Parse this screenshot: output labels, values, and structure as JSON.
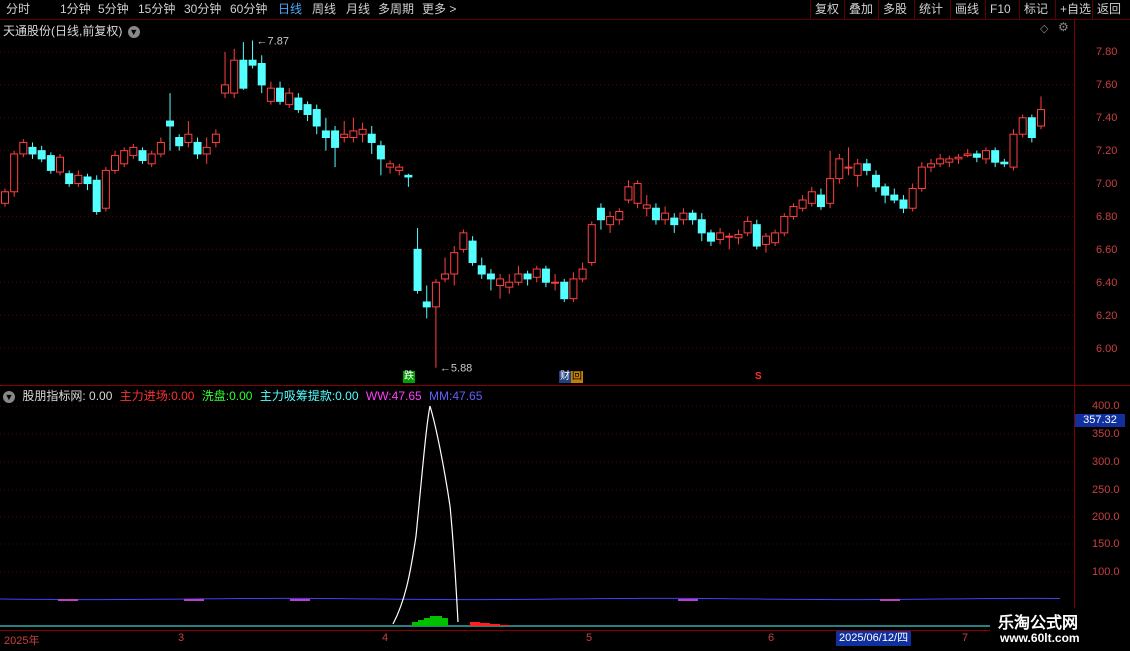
{
  "toolbar": {
    "periods": [
      "分时",
      "1分钟",
      "5分钟",
      "15分钟",
      "30分钟",
      "60分钟",
      "日线",
      "周线",
      "月线",
      "多周期",
      "更多 >"
    ],
    "active_period": "日线",
    "right_buttons": [
      "复权",
      "叠加",
      "多股",
      "统计",
      "画线",
      "F10",
      "标记",
      "+自选",
      "返回"
    ]
  },
  "stock": {
    "title": "天通股份(日线,前复权)"
  },
  "price_axis": {
    "labels": [
      "7.80",
      "7.60",
      "7.40",
      "7.20",
      "7.00",
      "6.80",
      "6.60",
      "6.40",
      "6.20",
      "6.00"
    ]
  },
  "annotations": {
    "high": "7.87",
    "low": "5.88",
    "badge_fall": "跌",
    "badge_fin": "财",
    "badge_hui": "回",
    "badge_s": "S"
  },
  "indicator": {
    "name": "股朋指标网",
    "name_value": ": 0.00",
    "entry_label": "主力进场:",
    "entry_value": "0.00",
    "wash_label": "洗盘:",
    "wash_value": "0.00",
    "absorb_label": "主力吸筹提款:",
    "absorb_value": "0.00",
    "ww_label": "WW:",
    "ww_value": "47.65",
    "mm_label": "MM:",
    "mm_value": "47.65",
    "axis_labels": [
      "400.0",
      "350.0",
      "300.0",
      "250.0",
      "200.0",
      "150.0",
      "100.0"
    ],
    "current_value": "357.32"
  },
  "date_axis": {
    "labels": [
      "2025年",
      "3",
      "4",
      "5",
      "6",
      "7"
    ],
    "highlight": "2025/06/12/四"
  },
  "watermark": {
    "line1": "乐淘公式网",
    "line2": "www.60lt.com"
  },
  "colors": {
    "up": "#ff4040",
    "down": "#54ffff",
    "axis": "#c84040",
    "grid": "#7a0000"
  },
  "chart_data": {
    "type": "candlestick",
    "ylim": [
      5.85,
      7.92
    ],
    "candles": [
      [
        6.88,
        6.95,
        6.97,
        6.86
      ],
      [
        6.95,
        7.18,
        7.2,
        6.92
      ],
      [
        7.18,
        7.25,
        7.27,
        7.16
      ],
      [
        7.22,
        7.18,
        7.25,
        7.15
      ],
      [
        7.2,
        7.15,
        7.23,
        7.13
      ],
      [
        7.17,
        7.08,
        7.19,
        7.06
      ],
      [
        7.07,
        7.16,
        7.18,
        7.05
      ],
      [
        7.06,
        7.0,
        7.08,
        6.98
      ],
      [
        7.0,
        7.05,
        7.08,
        6.98
      ],
      [
        7.04,
        7.0,
        7.06,
        6.96
      ],
      [
        7.02,
        6.83,
        7.05,
        6.81
      ],
      [
        6.85,
        7.08,
        7.1,
        6.83
      ],
      [
        7.08,
        7.17,
        7.2,
        7.06
      ],
      [
        7.12,
        7.2,
        7.22,
        7.1
      ],
      [
        7.17,
        7.22,
        7.24,
        7.15
      ],
      [
        7.2,
        7.14,
        7.22,
        7.12
      ],
      [
        7.12,
        7.18,
        7.2,
        7.1
      ],
      [
        7.18,
        7.25,
        7.28,
        7.16
      ],
      [
        7.38,
        7.35,
        7.55,
        7.2
      ],
      [
        7.28,
        7.23,
        7.3,
        7.2
      ],
      [
        7.25,
        7.3,
        7.38,
        7.22
      ],
      [
        7.25,
        7.18,
        7.28,
        7.15
      ],
      [
        7.18,
        7.22,
        7.28,
        7.12
      ],
      [
        7.25,
        7.3,
        7.33,
        7.22
      ],
      [
        7.55,
        7.6,
        7.8,
        7.52
      ],
      [
        7.55,
        7.75,
        7.82,
        7.52
      ],
      [
        7.75,
        7.58,
        7.86,
        7.57
      ],
      [
        7.75,
        7.72,
        7.87,
        7.7
      ],
      [
        7.73,
        7.6,
        7.78,
        7.55
      ],
      [
        7.5,
        7.58,
        7.62,
        7.48
      ],
      [
        7.58,
        7.5,
        7.62,
        7.48
      ],
      [
        7.48,
        7.55,
        7.58,
        7.46
      ],
      [
        7.52,
        7.45,
        7.55,
        7.43
      ],
      [
        7.48,
        7.42,
        7.5,
        7.38
      ],
      [
        7.45,
        7.35,
        7.48,
        7.3
      ],
      [
        7.32,
        7.28,
        7.4,
        7.2
      ],
      [
        7.32,
        7.22,
        7.35,
        7.1
      ],
      [
        7.28,
        7.3,
        7.38,
        7.25
      ],
      [
        7.28,
        7.32,
        7.4,
        7.25
      ],
      [
        7.3,
        7.33,
        7.37,
        7.25
      ],
      [
        7.3,
        7.25,
        7.35,
        7.18
      ],
      [
        7.23,
        7.15,
        7.26,
        7.05
      ],
      [
        7.1,
        7.12,
        7.14,
        7.06
      ],
      [
        7.08,
        7.1,
        7.12,
        7.05
      ],
      [
        7.05,
        7.04,
        7.06,
        6.98
      ],
      [
        6.6,
        6.35,
        6.73,
        6.33
      ],
      [
        6.28,
        6.25,
        6.38,
        6.18
      ],
      [
        6.25,
        6.4,
        6.42,
        5.88
      ],
      [
        6.42,
        6.45,
        6.55,
        6.4
      ],
      [
        6.45,
        6.58,
        6.62,
        6.38
      ],
      [
        6.6,
        6.7,
        6.72,
        6.58
      ],
      [
        6.65,
        6.52,
        6.68,
        6.5
      ],
      [
        6.5,
        6.45,
        6.55,
        6.42
      ],
      [
        6.45,
        6.42,
        6.48,
        6.35
      ],
      [
        6.38,
        6.42,
        6.45,
        6.3
      ],
      [
        6.37,
        6.4,
        6.45,
        6.33
      ],
      [
        6.4,
        6.45,
        6.5,
        6.38
      ],
      [
        6.45,
        6.42,
        6.47,
        6.38
      ],
      [
        6.43,
        6.48,
        6.5,
        6.4
      ],
      [
        6.48,
        6.4,
        6.5,
        6.37
      ],
      [
        6.4,
        6.4,
        6.45,
        6.35
      ],
      [
        6.4,
        6.3,
        6.42,
        6.28
      ],
      [
        6.3,
        6.42,
        6.46,
        6.28
      ],
      [
        6.42,
        6.48,
        6.52,
        6.4
      ],
      [
        6.52,
        6.75,
        6.77,
        6.5
      ],
      [
        6.85,
        6.78,
        6.88,
        6.72
      ],
      [
        6.75,
        6.8,
        6.83,
        6.7
      ],
      [
        6.78,
        6.83,
        6.85,
        6.75
      ],
      [
        6.9,
        6.98,
        7.02,
        6.88
      ],
      [
        6.88,
        7.0,
        7.02,
        6.85
      ],
      [
        6.85,
        6.87,
        6.93,
        6.8
      ],
      [
        6.85,
        6.78,
        6.88,
        6.75
      ],
      [
        6.78,
        6.82,
        6.86,
        6.75
      ],
      [
        6.79,
        6.75,
        6.82,
        6.7
      ],
      [
        6.78,
        6.82,
        6.85,
        6.75
      ],
      [
        6.82,
        6.78,
        6.84,
        6.75
      ],
      [
        6.78,
        6.7,
        6.82,
        6.65
      ],
      [
        6.7,
        6.65,
        6.72,
        6.62
      ],
      [
        6.66,
        6.7,
        6.73,
        6.63
      ],
      [
        6.68,
        6.68,
        6.7,
        6.6
      ],
      [
        6.67,
        6.69,
        6.72,
        6.63
      ],
      [
        6.7,
        6.77,
        6.8,
        6.68
      ],
      [
        6.75,
        6.62,
        6.78,
        6.6
      ],
      [
        6.63,
        6.68,
        6.7,
        6.58
      ],
      [
        6.64,
        6.7,
        6.72,
        6.62
      ],
      [
        6.7,
        6.8,
        6.82,
        6.68
      ],
      [
        6.8,
        6.86,
        6.88,
        6.78
      ],
      [
        6.85,
        6.9,
        6.93,
        6.83
      ],
      [
        6.88,
        6.95,
        6.98,
        6.86
      ],
      [
        6.93,
        6.86,
        6.97,
        6.84
      ],
      [
        6.88,
        7.03,
        7.2,
        6.85
      ],
      [
        7.03,
        7.15,
        7.18,
        7.0
      ],
      [
        7.1,
        7.1,
        7.22,
        7.05
      ],
      [
        7.05,
        7.12,
        7.15,
        6.98
      ],
      [
        7.12,
        7.08,
        7.15,
        7.05
      ],
      [
        7.05,
        6.98,
        7.08,
        6.95
      ],
      [
        6.98,
        6.93,
        7.0,
        6.88
      ],
      [
        6.93,
        6.9,
        6.97,
        6.88
      ],
      [
        6.9,
        6.85,
        6.93,
        6.82
      ],
      [
        6.85,
        6.97,
        7.0,
        6.83
      ],
      [
        6.97,
        7.1,
        7.13,
        6.95
      ],
      [
        7.1,
        7.12,
        7.15,
        7.07
      ],
      [
        7.12,
        7.15,
        7.18,
        7.1
      ],
      [
        7.13,
        7.15,
        7.17,
        7.1
      ],
      [
        7.15,
        7.16,
        7.18,
        7.12
      ],
      [
        7.17,
        7.18,
        7.21,
        7.16
      ],
      [
        7.18,
        7.16,
        7.2,
        7.13
      ],
      [
        7.15,
        7.2,
        7.22,
        7.12
      ],
      [
        7.2,
        7.13,
        7.22,
        7.1
      ],
      [
        7.13,
        7.12,
        7.15,
        7.1
      ],
      [
        7.1,
        7.3,
        7.33,
        7.08
      ],
      [
        7.3,
        7.4,
        7.42,
        7.28
      ],
      [
        7.4,
        7.28,
        7.42,
        7.25
      ],
      [
        7.35,
        7.45,
        7.53,
        7.33
      ]
    ],
    "indicator_series": {
      "ww_line": "white spike peaking near 400 around mid-April 2025",
      "bars_green": [
        0,
        0,
        4,
        6,
        8,
        10,
        10,
        8
      ],
      "bars_red": [
        0,
        0,
        0,
        0,
        4,
        3,
        2,
        1
      ]
    }
  }
}
